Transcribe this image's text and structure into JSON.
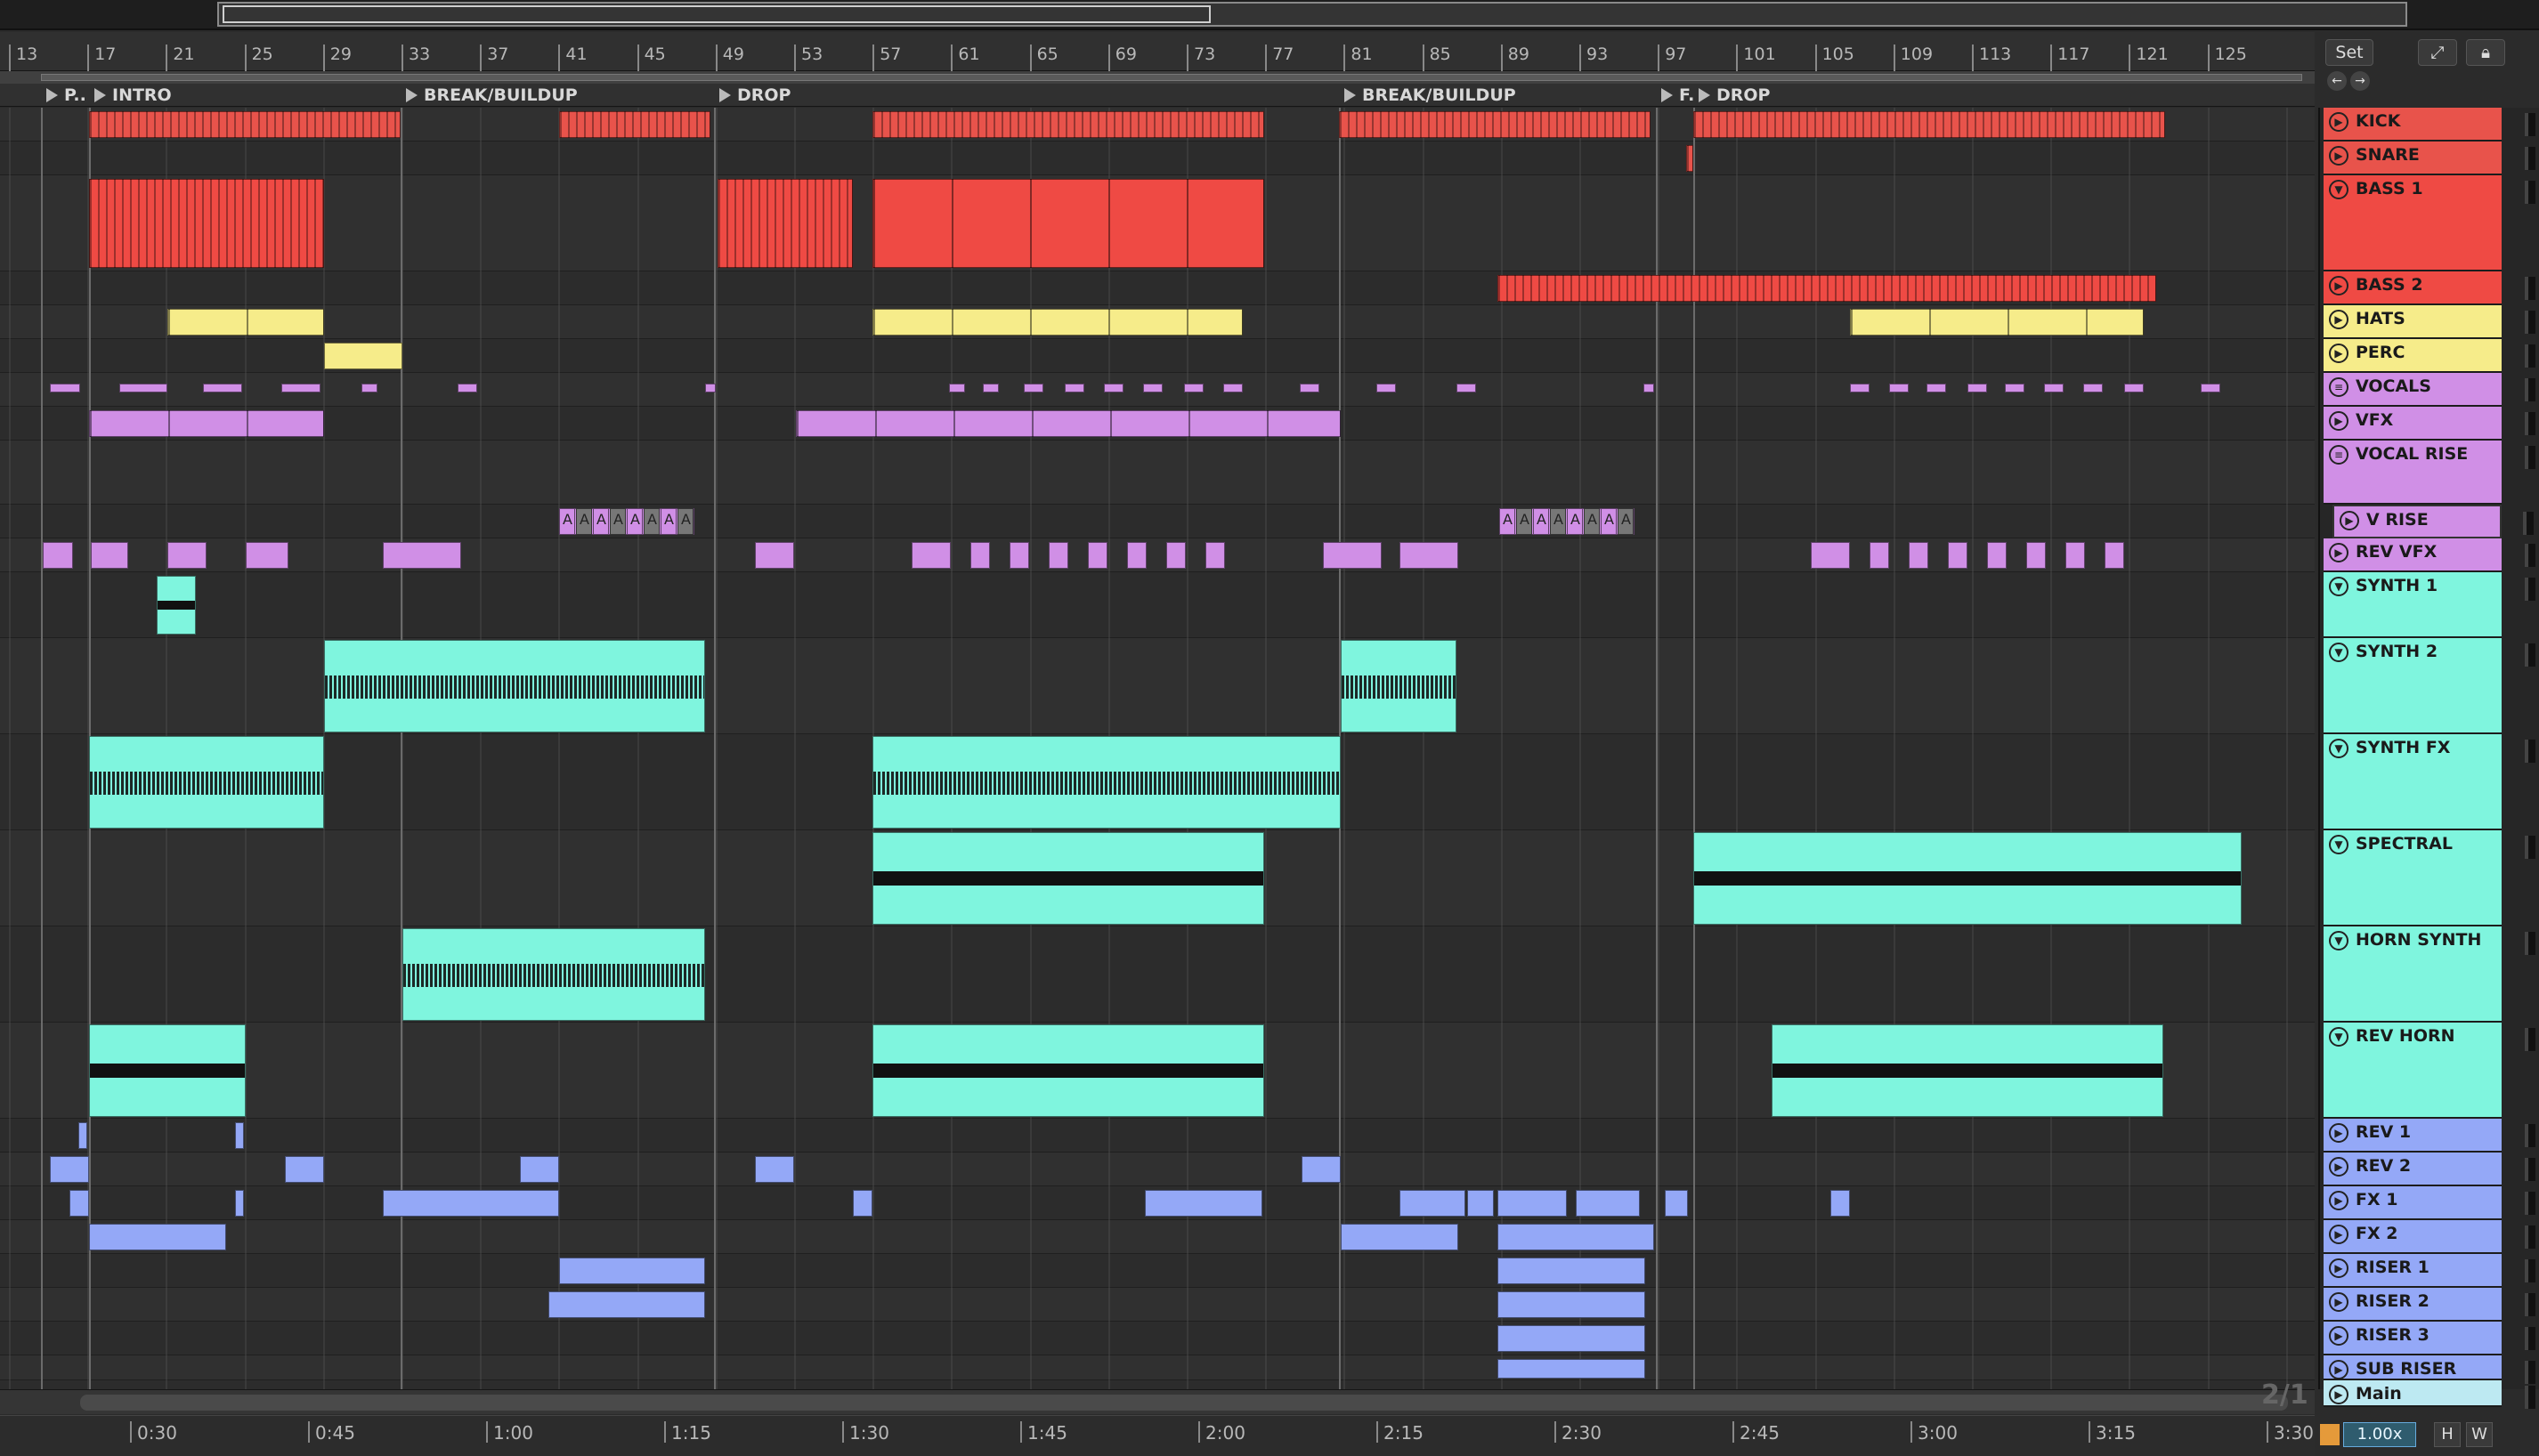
{
  "overview": {
    "label": "arrangement-overview"
  },
  "ruler": {
    "bars": [
      "13",
      "17",
      "21",
      "25",
      "29",
      "33",
      "37",
      "41",
      "45",
      "49",
      "53",
      "57",
      "61",
      "65",
      "69",
      "73",
      "77",
      "81",
      "85",
      "89",
      "93",
      "97",
      "101",
      "105",
      "109",
      "113",
      "117",
      "121",
      "125"
    ]
  },
  "locators": [
    {
      "label": "P.."
    },
    {
      "label": "INTRO"
    },
    {
      "label": "BREAK/BUILDUP"
    },
    {
      "label": "DROP"
    },
    {
      "label": "BREAK/BUILDUP"
    },
    {
      "label": "F."
    },
    {
      "label": "DROP"
    }
  ],
  "top_controls": {
    "set_label": "Set",
    "expand_icon": "expand-icon",
    "lock_icon": "lock-icon"
  },
  "tracks": [
    {
      "name": "KICK",
      "color": "#e8534b",
      "icon": "play-icon"
    },
    {
      "name": "SNARE",
      "color": "#e8534b",
      "icon": "play-icon"
    },
    {
      "name": "BASS 1",
      "color": "#ef4a44",
      "icon": "fold-icon"
    },
    {
      "name": "BASS 2",
      "color": "#ef4a44",
      "icon": "play-icon"
    },
    {
      "name": "HATS",
      "color": "#f6ec8a",
      "icon": "play-icon"
    },
    {
      "name": "PERC",
      "color": "#f6ec8a",
      "icon": "play-icon"
    },
    {
      "name": "VOCALS",
      "color": "#d08fe6",
      "icon": "group-icon"
    },
    {
      "name": "VFX",
      "color": "#d08fe6",
      "icon": "play-icon"
    },
    {
      "name": "VOCAL RISE",
      "color": "#d08fe6",
      "icon": "group-icon"
    },
    {
      "name": "V RISE",
      "color": "#d08fe6",
      "icon": "play-icon"
    },
    {
      "name": "REV VFX",
      "color": "#d08fe6",
      "icon": "play-icon"
    },
    {
      "name": "SYNTH 1",
      "color": "#7ff5de",
      "icon": "fold-icon"
    },
    {
      "name": "SYNTH 2",
      "color": "#7ff5de",
      "icon": "fold-icon"
    },
    {
      "name": "SYNTH FX",
      "color": "#7ff5de",
      "icon": "fold-icon"
    },
    {
      "name": "SPECTRAL",
      "color": "#7ff5de",
      "icon": "fold-icon"
    },
    {
      "name": "HORN SYNTH",
      "color": "#7ff5de",
      "icon": "fold-icon"
    },
    {
      "name": "REV HORN",
      "color": "#7ff5de",
      "icon": "fold-icon"
    },
    {
      "name": "REV 1",
      "color": "#94a8f7",
      "icon": "play-icon"
    },
    {
      "name": "REV 2",
      "color": "#94a8f7",
      "icon": "play-icon"
    },
    {
      "name": "FX 1",
      "color": "#94a8f7",
      "icon": "play-icon"
    },
    {
      "name": "FX 2",
      "color": "#94a8f7",
      "icon": "play-icon"
    },
    {
      "name": "RISER 1",
      "color": "#94a8f7",
      "icon": "play-icon"
    },
    {
      "name": "RISER 2",
      "color": "#94a8f7",
      "icon": "play-icon"
    },
    {
      "name": "RISER 3",
      "color": "#94a8f7",
      "icon": "play-icon"
    },
    {
      "name": "SUB RISER",
      "color": "#94a8f7",
      "icon": "play-icon"
    },
    {
      "name": "Main",
      "color": "#bde9f2",
      "icon": "play-icon"
    }
  ],
  "timeline": {
    "ticks": [
      "0:30",
      "0:45",
      "1:00",
      "1:15",
      "1:30",
      "1:45",
      "2:00",
      "2:15",
      "2:30",
      "2:45",
      "3:00",
      "3:15",
      "3:30"
    ]
  },
  "page_indicator": "2/1",
  "zoom": {
    "value": "1.00x",
    "h_label": "H",
    "w_label": "W"
  },
  "clip_labels": {
    "vocal_rise_letter": "A"
  },
  "colors": {
    "red": "#ef4a44",
    "yellow": "#f6ec8a",
    "purple": "#d08fe6",
    "cyan": "#7ff5de",
    "blue": "#94a8f7"
  }
}
